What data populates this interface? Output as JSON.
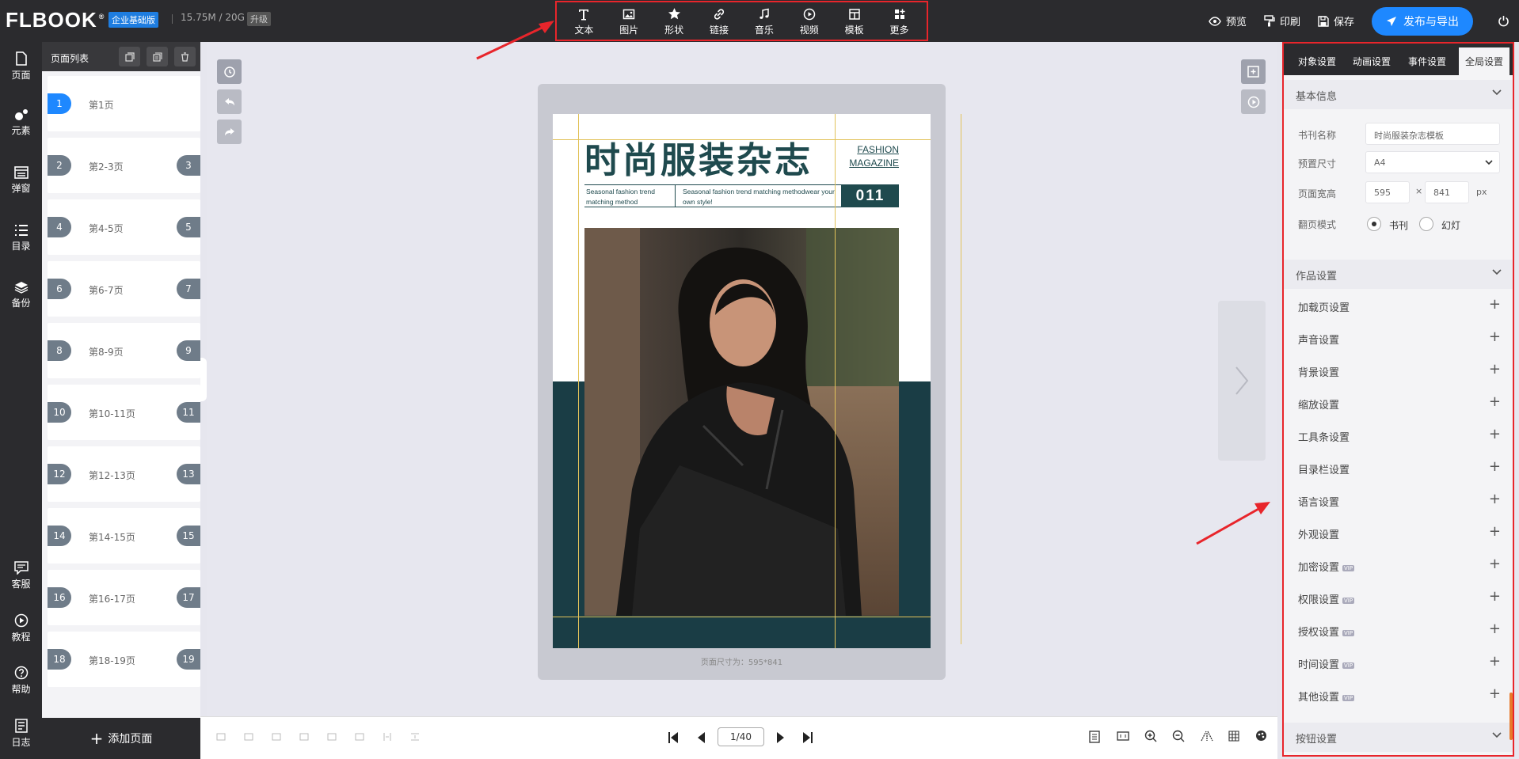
{
  "header": {
    "logo": "FLBOOK",
    "edition": "企业基础版",
    "storage": "15.75M / 20G",
    "upgrade": "升级",
    "tools": [
      {
        "label": "文本",
        "icon": "text-icon"
      },
      {
        "label": "图片",
        "icon": "image-icon"
      },
      {
        "label": "形状",
        "icon": "star-icon"
      },
      {
        "label": "链接",
        "icon": "link-icon"
      },
      {
        "label": "音乐",
        "icon": "music-icon"
      },
      {
        "label": "视频",
        "icon": "video-icon"
      },
      {
        "label": "模板",
        "icon": "template-icon"
      },
      {
        "label": "更多",
        "icon": "more-icon"
      }
    ],
    "preview": "预览",
    "print": "印刷",
    "save": "保存",
    "publish": "发布与导出"
  },
  "leftnav": [
    {
      "label": "页面",
      "icon": "page-icon"
    },
    {
      "label": "元素",
      "icon": "elements-icon"
    },
    {
      "label": "弹窗",
      "icon": "popup-icon"
    },
    {
      "label": "目录",
      "icon": "list-icon"
    },
    {
      "label": "备份",
      "icon": "layers-icon"
    },
    {
      "label": "客服",
      "icon": "chat-icon"
    },
    {
      "label": "教程",
      "icon": "play-icon"
    },
    {
      "label": "帮助",
      "icon": "help-icon"
    },
    {
      "label": "日志",
      "icon": "log-icon"
    }
  ],
  "pagepanel": {
    "title": "页面列表",
    "pages": [
      {
        "label": "第1页",
        "left": "1",
        "right": ""
      },
      {
        "label": "第2-3页",
        "left": "2",
        "right": "3"
      },
      {
        "label": "第4-5页",
        "left": "4",
        "right": "5"
      },
      {
        "label": "第6-7页",
        "left": "6",
        "right": "7"
      },
      {
        "label": "第8-9页",
        "left": "8",
        "right": "9"
      },
      {
        "label": "第10-11页",
        "left": "10",
        "right": "11"
      },
      {
        "label": "第12-13页",
        "left": "12",
        "right": "13"
      },
      {
        "label": "第14-15页",
        "left": "14",
        "right": "15"
      },
      {
        "label": "第16-17页",
        "left": "16",
        "right": "17"
      },
      {
        "label": "第18-19页",
        "left": "18",
        "right": "19"
      }
    ],
    "add_page": "添加页面"
  },
  "magazine": {
    "title": "时尚服装杂志",
    "fashion1": "FASHION",
    "fashion2": "MAGAZINE",
    "box1": "Seasonal fashion trend matching method",
    "box2": "Seasonal fashion trend matching methodwear your own style!",
    "issue": "011",
    "page_size": "页面尺寸为：595*841"
  },
  "pager": {
    "value": "1/40"
  },
  "rightpanel": {
    "tabs": [
      "对象设置",
      "动画设置",
      "事件设置",
      "全局设置"
    ],
    "basic_info": "基本信息",
    "book_name_label": "书刊名称",
    "book_name": "时尚服装杂志模板",
    "preset_size_label": "预置尺寸",
    "preset_size": "A4",
    "page_wh_label": "页面宽高",
    "width": "595",
    "times": "×",
    "height": "841",
    "unit": "px",
    "flip_mode_label": "翻页模式",
    "flip_book": "书刊",
    "flip_slide": "幻灯",
    "work_settings": "作品设置",
    "rows": [
      {
        "label": "加载页设置",
        "vip": false
      },
      {
        "label": "声音设置",
        "vip": false
      },
      {
        "label": "背景设置",
        "vip": false
      },
      {
        "label": "缩放设置",
        "vip": false
      },
      {
        "label": "工具条设置",
        "vip": false
      },
      {
        "label": "目录栏设置",
        "vip": false
      },
      {
        "label": "语言设置",
        "vip": false
      },
      {
        "label": "外观设置",
        "vip": false
      },
      {
        "label": "加密设置",
        "vip": true
      },
      {
        "label": "权限设置",
        "vip": true
      },
      {
        "label": "授权设置",
        "vip": true
      },
      {
        "label": "时间设置",
        "vip": true
      },
      {
        "label": "其他设置",
        "vip": true
      }
    ],
    "vip_badge": "VIP",
    "button_settings": "按钮设置"
  },
  "colors": {
    "accent": "#1e88ff",
    "highlight": "#e8252b",
    "teal": "#1f4a4e",
    "dark": "#2b2b2e"
  }
}
